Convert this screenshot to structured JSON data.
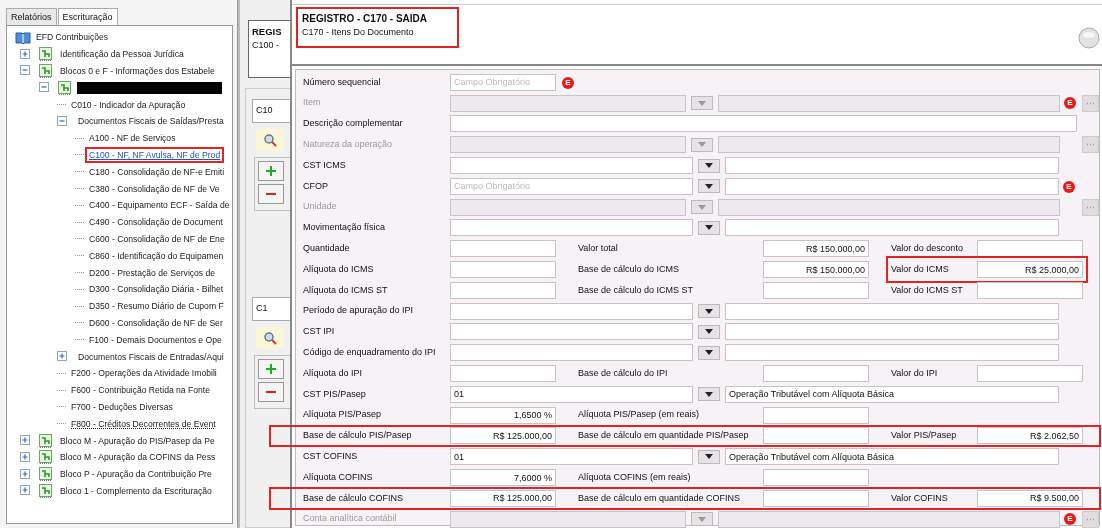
{
  "left_tabs": [
    {
      "label": "Relatórios",
      "selected": false
    },
    {
      "label": "Escrituração",
      "selected": true
    }
  ],
  "tree": [
    {
      "kind": "root",
      "label": "EFD Contribuições",
      "selected": false,
      "children": [
        {
          "kind": "block",
          "label": "Identificação da Pessoa Jurídica",
          "expanded": false,
          "selected": false
        },
        {
          "kind": "block",
          "label": "Blocos 0 e F - Informações dos Estabele",
          "expanded": true,
          "selected": false,
          "children": [
            {
              "kind": "redacted",
              "expanded": true,
              "children": [
                {
                  "kind": "leaf",
                  "label": "C010 - Indicador da Apuração",
                  "selected": false
                },
                {
                  "kind": "group",
                  "label": "Documentos Fiscais de Saídas/Presta",
                  "expanded": true,
                  "selected": false,
                  "children": [
                    {
                      "kind": "leaf",
                      "label": "A100 - NF de Serviços",
                      "selected": false
                    },
                    {
                      "kind": "leaf",
                      "label": "C100 - NF, NF Avulsa, NF de Prod",
                      "selected": true,
                      "highlighted": true
                    },
                    {
                      "kind": "leaf",
                      "label": "C180 - Consolidação de NF-e Emiti",
                      "selected": false
                    },
                    {
                      "kind": "leaf",
                      "label": "C380 - Consolidação de NF de Ve",
                      "selected": false
                    },
                    {
                      "kind": "leaf",
                      "label": "C400 - Equipamento ECF - Saída de",
                      "selected": false
                    },
                    {
                      "kind": "leaf",
                      "label": "C490 - Consolidação de Document",
                      "selected": false
                    },
                    {
                      "kind": "leaf",
                      "label": "C600 - Consolidação de NF de Ene",
                      "selected": false
                    },
                    {
                      "kind": "leaf",
                      "label": "C860 - Identificação do Equipamen",
                      "selected": false
                    },
                    {
                      "kind": "leaf",
                      "label": "D200 - Prestação de Serviços de",
                      "selected": false
                    },
                    {
                      "kind": "leaf",
                      "label": "D300 - Consolidação Diária - Bilhet",
                      "selected": false
                    },
                    {
                      "kind": "leaf",
                      "label": "D350 - Resumo Diário de Cupom F",
                      "selected": false
                    },
                    {
                      "kind": "leaf",
                      "label": "D600 - Consolidação de NF de Ser",
                      "selected": false
                    },
                    {
                      "kind": "leaf",
                      "label": "F100 - Demais Documentos e Ope",
                      "selected": false
                    }
                  ]
                },
                {
                  "kind": "group",
                  "label": "Documentos Fiscais de Entradas/Aqui",
                  "expanded": false,
                  "selected": false
                },
                {
                  "kind": "leaf",
                  "label": "F200 - Operações da Atividade Imobili",
                  "selected": false
                },
                {
                  "kind": "leaf",
                  "label": "F600 - Contribuição Retida na Fonte",
                  "selected": false
                },
                {
                  "kind": "leaf",
                  "label": "F700 - Deduções Diversas",
                  "selected": false
                },
                {
                  "kind": "leaf",
                  "label": "F800 - Créditos Decorrentes de Event",
                  "selected": false,
                  "focused": true
                }
              ]
            }
          ]
        },
        {
          "kind": "block",
          "label": "Bloco M - Apuração do PIS/Pasep da Pe",
          "expanded": false,
          "selected": false
        },
        {
          "kind": "block",
          "label": "Bloco M - Apuração da COFINS da Pess",
          "expanded": false,
          "selected": false
        },
        {
          "kind": "block",
          "label": "Bloco P - Apuração da Contribuição Pre",
          "expanded": false,
          "selected": false
        },
        {
          "kind": "block",
          "label": "Bloco 1 - Complemento da Escrituração",
          "expanded": false,
          "selected": false
        }
      ]
    }
  ],
  "behind_window": {
    "title": "REGIS",
    "subtitle": "C100 -",
    "sections": [
      {
        "tab": "C10"
      },
      {
        "tab": "C1"
      }
    ]
  },
  "dialog": {
    "title": "REGISTRO - C170 - SAIDA",
    "subtitle": "C170 - Itens Do Documento",
    "highlighted": true
  },
  "rows": [
    {
      "kind": "short",
      "label": "Número sequencial",
      "placeholder": "Campo Obrigatório",
      "badge": "E"
    },
    {
      "kind": "lookup",
      "label": "Item",
      "disabled": true,
      "badge": "E"
    },
    {
      "kind": "wide",
      "label": "Descrição complementar"
    },
    {
      "kind": "lookup",
      "label": "Natureza da operação",
      "disabled": true
    },
    {
      "kind": "combo",
      "label": "CST ICMS"
    },
    {
      "kind": "combo",
      "label": "CFOP",
      "placeholder": "Campo Obrigatório",
      "badge": "E"
    },
    {
      "kind": "lookup",
      "label": "Unidade",
      "disabled": true
    },
    {
      "kind": "combo",
      "label": "Movimentação física"
    },
    {
      "kind": "multi",
      "label": "Quantidade",
      "cells": [
        {
          "label": "Valor total",
          "value": "R$ 150.000,00"
        },
        {
          "label": "Valor do desconto"
        }
      ]
    },
    {
      "kind": "multi",
      "label": "Alíquota do ICMS",
      "cells": [
        {
          "label": "Base de cálculo do ICMS",
          "value": "R$ 150.000,00"
        },
        {
          "label": "Valor do ICMS",
          "value": "R$ 25.000,00",
          "highlighted": true
        }
      ]
    },
    {
      "kind": "multi",
      "label": "Alíquota do ICMS ST",
      "cells": [
        {
          "label": "Base de cálculo do ICMS ST"
        },
        {
          "label": "Valor do ICMS ST"
        }
      ]
    },
    {
      "kind": "combo",
      "label": "Período de apuração do IPI"
    },
    {
      "kind": "combo",
      "label": "CST IPI"
    },
    {
      "kind": "combo",
      "label": "Código de enquadramento do IPI"
    },
    {
      "kind": "multi",
      "label": "Alíquota do IPI",
      "cells": [
        {
          "label": "Base de cálculo do IPI"
        },
        {
          "label": "Valor do IPI"
        }
      ]
    },
    {
      "kind": "combo",
      "label": "CST PIS/Pasep",
      "value": "01",
      "value2": "Operação Tributável com Alíquota Básica"
    },
    {
      "kind": "multi",
      "label": "Alíquota PIS/Pasep",
      "value": "1,6500 %",
      "cells": [
        {
          "label": "Alíquota PIS/Pasep (em reais)"
        }
      ]
    },
    {
      "kind": "multi",
      "label": "Base de cálculo PIS/Pasep",
      "value": "R$ 125.000,00",
      "highlighted": true,
      "cells": [
        {
          "label": "Base de cálculo em quantidade PIS/Pasep"
        },
        {
          "label": "Valor PIS/Pasep",
          "value": "R$ 2.062,50"
        }
      ]
    },
    {
      "kind": "combo",
      "label": "CST COFINS",
      "value": "01",
      "value2": "Operação Tributável com Alíquota Básica"
    },
    {
      "kind": "multi",
      "label": "Alíquota COFINS",
      "value": "7,6000 %",
      "cells": [
        {
          "label": "Alíquota COFINS (em reais)"
        }
      ]
    },
    {
      "kind": "multi",
      "label": "Base de cálculo COFINS",
      "value": "R$ 125.000,00",
      "highlighted": true,
      "cells": [
        {
          "label": "Base de cálculo em quantidade COFINS"
        },
        {
          "label": "Valor COFINS",
          "value": "R$ 9.500,00"
        }
      ]
    },
    {
      "kind": "lookup",
      "label": "Conta analítica contábil",
      "disabled": true,
      "badge": "E"
    }
  ]
}
